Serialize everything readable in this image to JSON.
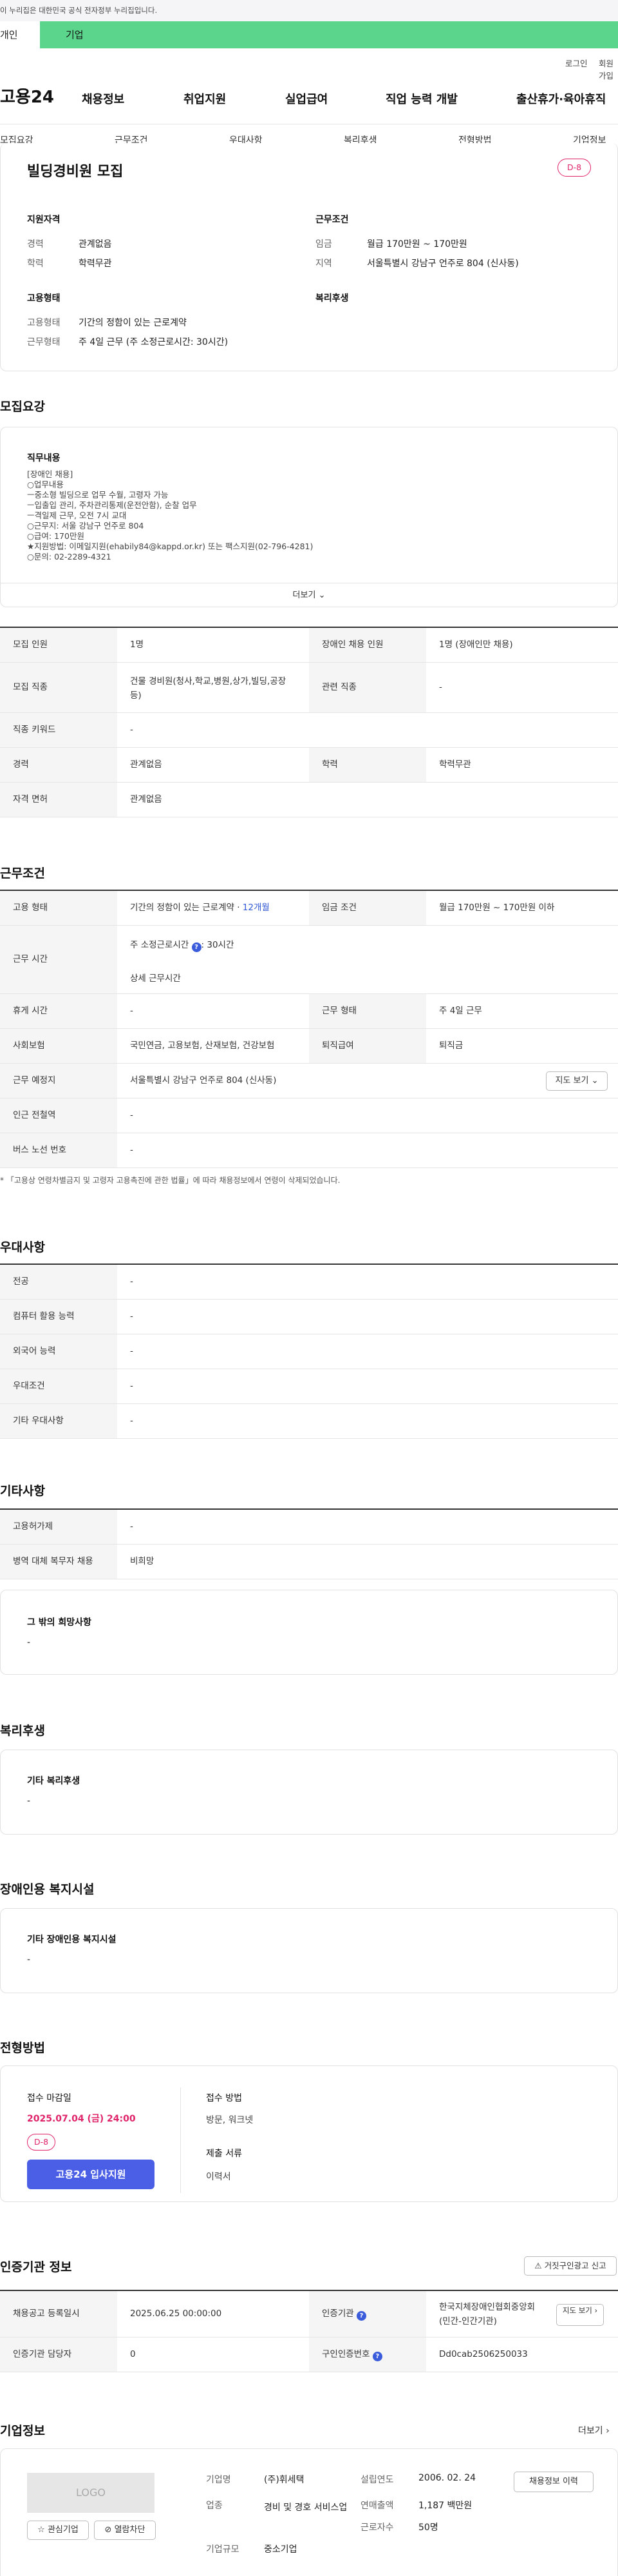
{
  "gov_banner": "이 누리집은 대한민국 공식 전자정부 누리집입니다.",
  "tabs": {
    "person": "개인",
    "corp": "기업"
  },
  "util": {
    "login": "로그인",
    "join": "회원가입"
  },
  "logo": "고용24",
  "gnb": [
    "채용정보",
    "취업지원",
    "실업급여",
    "직업 능력 개발",
    "출산휴가·육아휴직"
  ],
  "subnav": [
    "모집요강",
    "근무조건",
    "우대사항",
    "복리후생",
    "전형방법",
    "기업정보"
  ],
  "job": {
    "title": "빌딩경비원 모집",
    "dday": "D-8",
    "qual_title": "지원자격",
    "qual": [
      {
        "k": "경력",
        "v": "관계없음"
      },
      {
        "k": "학력",
        "v": "학력무관"
      }
    ],
    "cond_title": "근무조건",
    "cond": [
      {
        "k": "임금",
        "v": "월급 170만원 ~ 170만원"
      },
      {
        "k": "지역",
        "v": "서울특별시 강남구 언주로 804 (신사동)"
      }
    ],
    "emp_title": "고용형태",
    "emp": [
      {
        "k": "고용형태",
        "v": "기간의 정함이 있는 근로계약"
      },
      {
        "k": "근무형태",
        "v": "주 4일 근무 (주 소정근로시간: 30시간)"
      }
    ],
    "welfare_title": "복리후생"
  },
  "recruit": {
    "title": "모집요강",
    "duty_title": "직무내용",
    "duty_lines": [
      "[장애인 채용]",
      "○업무내용",
      "ㅡ중소형 빌딩으로 업무 수월, 고령자 가능",
      "ㅡ입출입 관리, 주차관리통제(운전안함), 순찰 업무",
      "ㅡ격일제 근무, 오전 7시 교대",
      "○근무지: 서울 강남구 언주로 804",
      "○급여: 170만원",
      "★지원방법: 이메일지원(ehabily84@kappd.or.kr) 또는 팩스지원(02-796-4281)",
      "○문의: 02-2289-4321"
    ],
    "more": "더보기",
    "rows": [
      {
        "k1": "모집 인원",
        "v1": "1명",
        "k2": "장애인 채용 인원",
        "v2": "1명 (장애인만 채용)"
      },
      {
        "k1": "모집 직종",
        "v1": "건물 경비원(청사,학교,병원,상가,빌딩,공장 등)",
        "k2": "관련 직종",
        "v2": "-"
      },
      {
        "k1": "직종 키워드",
        "v1": "-"
      },
      {
        "k1": "경력",
        "v1": "관계없음",
        "k2": "학력",
        "v2": "학력무관"
      },
      {
        "k1": "자격 면허",
        "v1": "관계없음"
      }
    ]
  },
  "work": {
    "title": "근무조건",
    "emp_type_k": "고용 형태",
    "emp_type_v": "기간의 정함이 있는 근로계약 · ",
    "emp_type_months": "12개월",
    "wage_k": "임금 조건",
    "wage_v": "월급 170만원 ~ 170만원 이하",
    "hours_k": "근무 시간",
    "hours_weekly_label": "주 소정근로시간",
    "hours_weekly_value": ": 30시간",
    "hours_detail": "상세 근무시간",
    "rest_k": "휴게 시간",
    "rest_v": "-",
    "form_k": "근무 형태",
    "form_v": "주 4일 근무",
    "insurance_k": "사회보험",
    "insurance_v": "국민연금, 고용보험, 산재보험, 건강보험",
    "severance_k": "퇴직급여",
    "severance_v": "퇴직금",
    "place_k": "근무 예정지",
    "place_v": "서울특별시 강남구 언주로 804 (신사동)",
    "map_btn": "지도 보기",
    "subway_k": "인근 전철역",
    "subway_v": "-",
    "bus_k": "버스 노선 번호",
    "bus_v": "-",
    "note": "「고용상 연령차별금지 및 고령자 고용촉진에 관한 법률」에 따라 채용정보에서 연령이 삭제되었습니다."
  },
  "pref": {
    "title": "우대사항",
    "rows": [
      {
        "k": "전공",
        "v": "-"
      },
      {
        "k": "컴퓨터 활용 능력",
        "v": "-"
      },
      {
        "k": "외국어 능력",
        "v": "-"
      },
      {
        "k": "우대조건",
        "v": "-"
      },
      {
        "k": "기타 우대사항",
        "v": "-"
      }
    ]
  },
  "etc": {
    "title": "기타사항",
    "rows": [
      {
        "k": "고용허가제",
        "v": "-"
      },
      {
        "k": "병역 대체 복무자 채용",
        "v": "비희망"
      }
    ],
    "other_title": "그 밖의 희망사항",
    "other_value": "-"
  },
  "welfare": {
    "title": "복리후생",
    "box_title": "기타 복리후생",
    "box_value": "-"
  },
  "disability": {
    "title": "장애인용 복지시설",
    "box_title": "기타 장애인용 복지시설",
    "box_value": "-"
  },
  "screening": {
    "title": "전형방법",
    "deadline_title": "접수 마감일",
    "deadline": "2025.07.04 (금) 24:00",
    "dday": "D-8",
    "apply_btn": "고용24 입사지원",
    "method_title": "접수 방법",
    "method": "방문, 워크넷",
    "docs_title": "제출 서류",
    "docs": "이력서"
  },
  "cert": {
    "title": "인증기관 정보",
    "report_btn": "거짓구인광고 신고",
    "rows": [
      {
        "k1": "채용공고 등록일시",
        "v1": "2025.06.25 00:00:00",
        "k2": "인증기관",
        "v2": "한국지체장애인협회중앙회 (민간-인간기관)",
        "btn": "지도 보기"
      },
      {
        "k1": "인증기관 담당자",
        "v1": "0",
        "k2": "구인인증번호",
        "v2": "Dd0cab2506250033"
      }
    ]
  },
  "company": {
    "title": "기업정보",
    "more": "더보기",
    "logo": "LOGO",
    "fav_btn": "관심기업",
    "block_btn": "열람차단",
    "info_btn": "채용정보 이력",
    "fields": {
      "industry_k": "기업명",
      "industry_v": "(주)휘세택",
      "type_k": "업종",
      "type_v": "경비 및 경호 서비스업",
      "scale_k": "기업규모",
      "scale_v": "중소기업",
      "founded_k": "설립연도",
      "founded_v": "2006. 02. 24",
      "sales_k": "연매출액",
      "sales_v": "1,187 백만원",
      "staff_k": "근로자수",
      "staff_v": "50명"
    }
  }
}
